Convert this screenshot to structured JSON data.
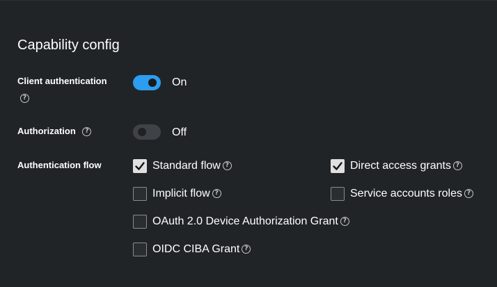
{
  "section": {
    "title": "Capability config"
  },
  "client_authentication": {
    "label": "Client authentication",
    "state": "On",
    "enabled": true
  },
  "authorization": {
    "label": "Authorization",
    "state": "Off",
    "enabled": false
  },
  "authentication_flow": {
    "label": "Authentication flow",
    "options": [
      {
        "label": "Standard flow",
        "checked": true
      },
      {
        "label": "Direct access grants",
        "checked": true
      },
      {
        "label": "Implicit flow",
        "checked": false
      },
      {
        "label": "Service accounts roles",
        "checked": false
      },
      {
        "label": "OAuth 2.0 Device Authorization Grant",
        "checked": false
      },
      {
        "label": "OIDC CIBA Grant",
        "checked": false
      }
    ]
  },
  "icons": {
    "help": "question-circle-icon",
    "check": "check-icon"
  },
  "colors": {
    "switch_on": "#2c9df0",
    "switch_off": "#3f4247",
    "background": "#212427"
  }
}
